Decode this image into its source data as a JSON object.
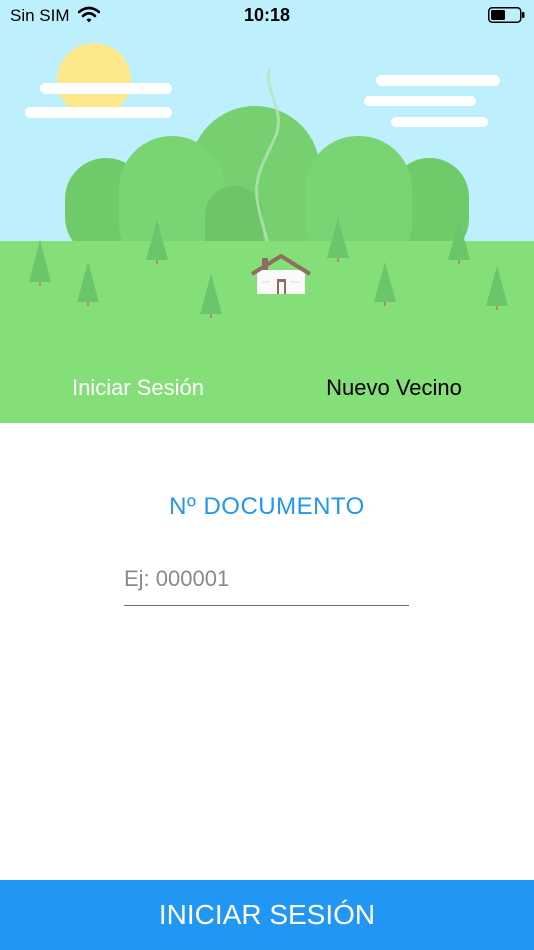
{
  "status_bar": {
    "carrier": "Sin SIM",
    "time": "10:18",
    "battery_level": 0.5
  },
  "tabs": {
    "login": "Iniciar Sesión",
    "register": "Nuevo Vecino"
  },
  "form": {
    "document_label": "Nº DOCUMENTO",
    "document_placeholder": "Ej: 000001",
    "document_value": ""
  },
  "submit_button": "INICIAR SESIÓN",
  "colors": {
    "sky": "#bdeffc",
    "grass": "#84df78",
    "hills_dark": "#6fcb6a",
    "hills_light": "#79d573",
    "sun": "#fde98c",
    "accent": "#2196f3",
    "tree": "#6bc66b"
  },
  "icons": {
    "wifi": "wifi-icon",
    "battery": "battery-icon",
    "sun": "sun-illustration",
    "house": "house-illustration"
  }
}
